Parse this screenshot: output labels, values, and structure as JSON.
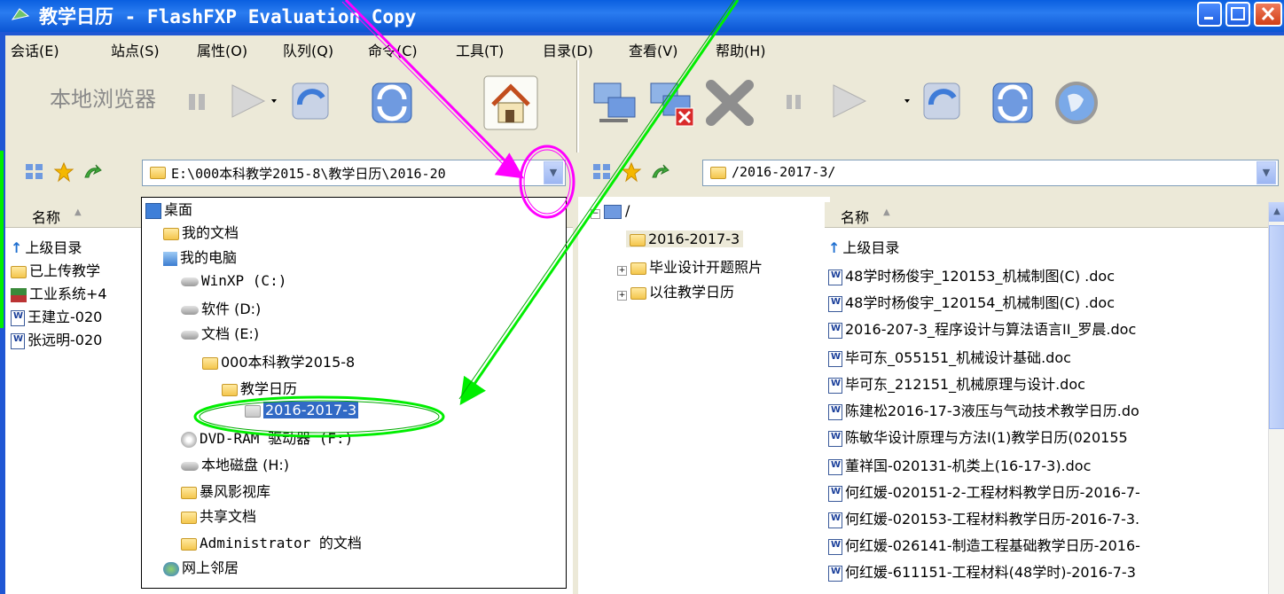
{
  "window": {
    "title": "教学日历 - FlashFXP Evaluation Copy"
  },
  "menu": [
    "会话(E)",
    "站点(S)",
    "属性(O)",
    "队列(Q)",
    "命令(C)",
    "工具(T)",
    "目录(D)",
    "查看(V)",
    "帮助(H)"
  ],
  "toolbar": {
    "local_browser_label": "本地浏览器"
  },
  "left_panel": {
    "path": "E:\\000本科教学2015-8\\教学日历\\2016-20",
    "column_name": "名称",
    "items": [
      "上级目录",
      "已上传教学",
      "工业系统+4",
      "王建立-020",
      "张远明-020"
    ]
  },
  "dropdown": {
    "items": [
      {
        "label": "桌面"
      },
      {
        "label": "我的文档"
      },
      {
        "label": "我的电脑"
      },
      {
        "label": "WinXP (C:)"
      },
      {
        "label": "软件 (D:)"
      },
      {
        "label": "文档 (E:)"
      },
      {
        "label": "000本科教学2015-8"
      },
      {
        "label": "教学日历"
      },
      {
        "label": "2016-2017-3"
      },
      {
        "label": "DVD-RAM 驱动器 (F:)"
      },
      {
        "label": "本地磁盘 (H:)"
      },
      {
        "label": "暴风影视库"
      },
      {
        "label": "共享文档"
      },
      {
        "label": "Administrator 的文档"
      },
      {
        "label": "网上邻居"
      }
    ]
  },
  "right_panel": {
    "path": "/2016-2017-3/",
    "tree": [
      "/",
      "2016-2017-3",
      "毕业设计开题照片",
      "以往教学日历"
    ],
    "column_name": "名称",
    "files": [
      "上级目录",
      "48学时杨俊宇_120153_机械制图(C) .doc",
      "48学时杨俊宇_120154_机械制图(C) .doc",
      "2016-207-3_程序设计与算法语言II_罗晨.doc",
      "毕可东_055151_机械设计基础.doc",
      "毕可东_212151_机械原理与设计.doc",
      "陈建松2016-17-3液压与气动技术教学日历.do",
      "陈敏华设计原理与方法Ⅰ(1)教学日历(020155",
      "董祥国-020131-机类上(16-17-3).doc",
      "何红媛-020151-2-工程材料教学日历-2016-7-",
      "何红媛-020153-工程材料教学日历-2016-7-3.",
      "何红媛-026141-制造工程基础教学日历-2016-",
      "何红媛-611151-工程材料(48学时)-2016-7-3"
    ]
  },
  "colors": {
    "titlebar": "#0a5fe0",
    "selection": "#316ac5",
    "annotation_magenta": "#ff00ff",
    "annotation_green": "#00ee00"
  }
}
